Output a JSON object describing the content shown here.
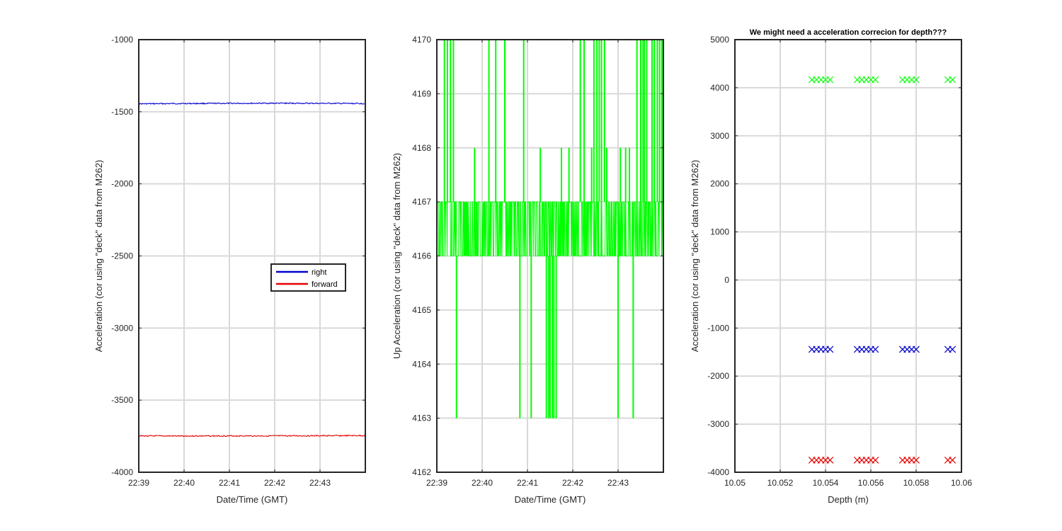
{
  "chart_data": [
    {
      "type": "line",
      "title": "",
      "xlabel": "Date/Time (GMT)",
      "ylabel": "Acceleration (cor using \"deck\" data from M262)",
      "xlim": [
        "22:39:00",
        "22:44:00"
      ],
      "ylim": [
        -4000,
        -1000
      ],
      "xticks": [
        "22:39",
        "22:40",
        "22:41",
        "22:42",
        "22:43"
      ],
      "yticks": [
        -1000,
        -1500,
        -2000,
        -2500,
        -3000,
        -3500,
        -4000
      ],
      "grid": true,
      "legend": {
        "placement": "center-right",
        "entries": [
          "right",
          "forward"
        ]
      },
      "series": [
        {
          "name": "right",
          "color": "#0000cc",
          "x": [
            "22:39:00",
            "22:40:00",
            "22:41:00",
            "22:42:00",
            "22:43:00",
            "22:44:00"
          ],
          "values": [
            -1445,
            -1443,
            -1442,
            -1441,
            -1442,
            -1443
          ]
        },
        {
          "name": "forward",
          "color": "#e60000",
          "x": [
            "22:39:00",
            "22:40:00",
            "22:41:00",
            "22:42:00",
            "22:43:00",
            "22:44:00"
          ],
          "values": [
            -3748,
            -3749,
            -3748,
            -3748,
            -3747,
            -3746
          ]
        }
      ]
    },
    {
      "type": "line",
      "title": "",
      "xlabel": "Date/Time (GMT)",
      "ylabel": "Up Acceleration (cor using \"deck\" data from M262)",
      "xlim": [
        "22:39:00",
        "22:44:00"
      ],
      "ylim": [
        4162,
        4170
      ],
      "xticks": [
        "22:39",
        "22:40",
        "22:41",
        "22:42",
        "22:43"
      ],
      "yticks": [
        4170,
        4169,
        4168,
        4167,
        4166,
        4165,
        4164,
        4163,
        4162
      ],
      "grid": true,
      "series": [
        {
          "color": "#00ff00",
          "band": [
            4166,
            4167
          ],
          "spikes": [
            {
              "x": "22:39:10",
              "to": 4170
            },
            {
              "x": "22:39:14",
              "to": 4170
            },
            {
              "x": "22:39:18",
              "to": 4170
            },
            {
              "x": "22:39:22",
              "to": 4170
            },
            {
              "x": "22:39:26",
              "to": 4163
            },
            {
              "x": "22:39:50",
              "to": 4168
            },
            {
              "x": "22:40:09",
              "to": 4170
            },
            {
              "x": "22:40:18",
              "to": 4170
            },
            {
              "x": "22:40:30",
              "to": 4170
            },
            {
              "x": "22:40:50",
              "to": 4163
            },
            {
              "x": "22:40:55",
              "to": 4170
            },
            {
              "x": "22:41:05",
              "to": 4163
            },
            {
              "x": "22:41:17",
              "to": 4168
            },
            {
              "x": "22:41:25",
              "to": 4163
            },
            {
              "x": "22:41:28",
              "to": 4163
            },
            {
              "x": "22:41:30",
              "to": 4163
            },
            {
              "x": "22:41:33",
              "to": 4163
            },
            {
              "x": "22:41:35",
              "to": 4163
            },
            {
              "x": "22:41:38",
              "to": 4163
            },
            {
              "x": "22:41:45",
              "to": 4168
            },
            {
              "x": "22:41:55",
              "to": 4168
            },
            {
              "x": "22:42:10",
              "to": 4170
            },
            {
              "x": "22:42:15",
              "to": 4170
            },
            {
              "x": "22:42:25",
              "to": 4168
            },
            {
              "x": "22:42:28",
              "to": 4170
            },
            {
              "x": "22:42:32",
              "to": 4170
            },
            {
              "x": "22:42:35",
              "to": 4170
            },
            {
              "x": "22:42:38",
              "to": 4170
            },
            {
              "x": "22:42:42",
              "to": 4170
            },
            {
              "x": "22:42:45",
              "to": 4168
            },
            {
              "x": "22:43:00",
              "to": 4163
            },
            {
              "x": "22:43:03",
              "to": 4168
            },
            {
              "x": "22:43:10",
              "to": 4168
            },
            {
              "x": "22:43:15",
              "to": 4168
            },
            {
              "x": "22:43:20",
              "to": 4163
            },
            {
              "x": "22:43:25",
              "to": 4170
            },
            {
              "x": "22:43:30",
              "to": 4170
            },
            {
              "x": "22:43:33",
              "to": 4170
            },
            {
              "x": "22:43:35",
              "to": 4170
            },
            {
              "x": "22:43:38",
              "to": 4170
            },
            {
              "x": "22:43:45",
              "to": 4170
            },
            {
              "x": "22:43:48",
              "to": 4170
            },
            {
              "x": "22:43:52",
              "to": 4170
            },
            {
              "x": "22:43:55",
              "to": 4170
            },
            {
              "x": "22:43:58",
              "to": 4170
            }
          ]
        }
      ]
    },
    {
      "type": "scatter",
      "title": "We might need a acceleration correcion for depth???",
      "xlabel": "Depth (m)",
      "ylabel": "Acceleration (cor using \"deck\" data from M262)",
      "xlim": [
        10.05,
        10.06
      ],
      "ylim": [
        -4000,
        5000
      ],
      "xticks": [
        10.05,
        10.052,
        10.054,
        10.056,
        10.058,
        10.06
      ],
      "yticks": [
        5000,
        4000,
        3000,
        2000,
        1000,
        0,
        -1000,
        -2000,
        -3000,
        -4000
      ],
      "grid": true,
      "marker": "x",
      "depths": [
        10.0534,
        10.0536,
        10.0538,
        10.054,
        10.0542,
        10.0554,
        10.0556,
        10.0558,
        10.056,
        10.0562,
        10.0574,
        10.0576,
        10.0578,
        10.058,
        10.0594,
        10.0596
      ],
      "series": [
        {
          "color": "#00ff00",
          "value": 4166
        },
        {
          "color": "#0000cc",
          "value": -1443
        },
        {
          "color": "#e60000",
          "value": -3748
        }
      ]
    }
  ]
}
